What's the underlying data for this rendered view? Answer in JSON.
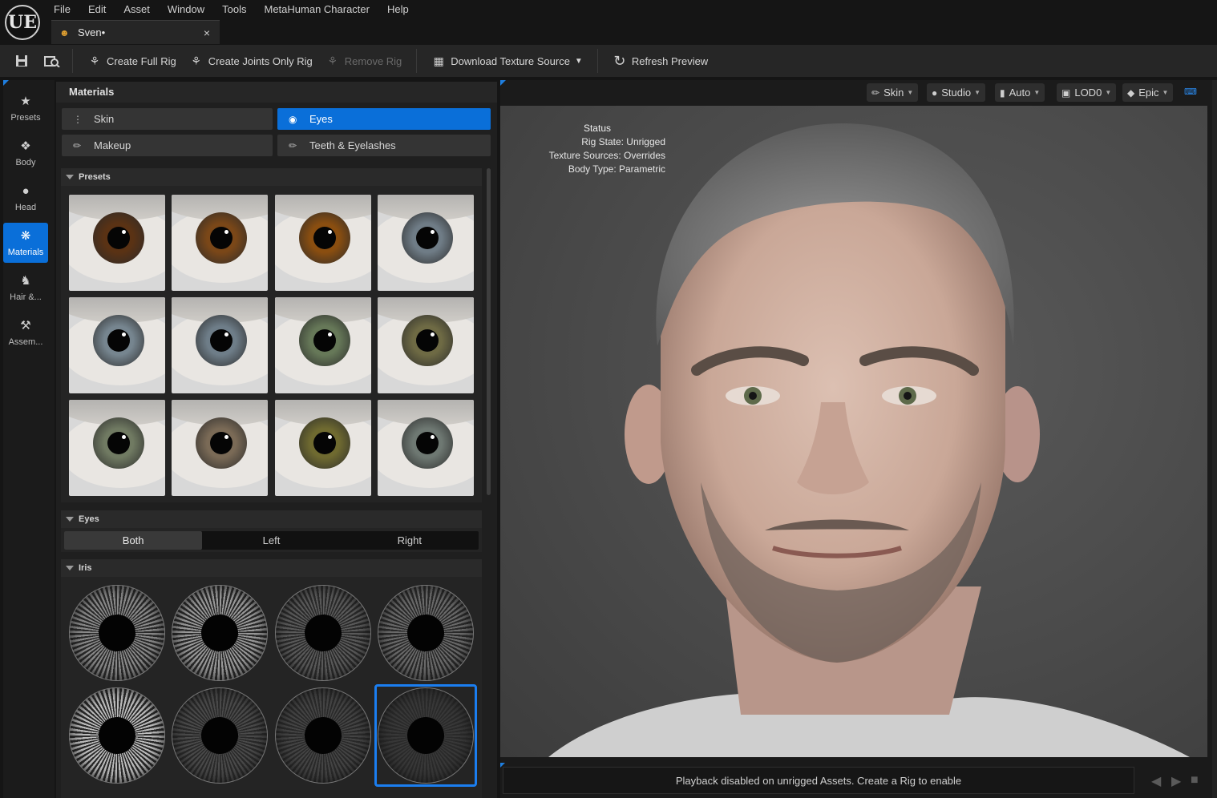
{
  "app": {
    "logo": "UE",
    "menu": [
      "File",
      "Edit",
      "Asset",
      "Window",
      "Tools",
      "MetaHuman Character",
      "Help"
    ],
    "doc_tab": {
      "label": "Sven•",
      "icon": "metahuman-character-icon",
      "close": "×"
    }
  },
  "toolbar": {
    "save_icon": "save-icon",
    "browse_icon": "browse-asset-icon",
    "create_full_rig": "Create Full Rig",
    "create_joints_only_rig": "Create Joints Only Rig",
    "remove_rig": "Remove Rig",
    "download_texture_source": "Download Texture Source",
    "refresh_preview": "Refresh Preview"
  },
  "rail": {
    "items": [
      {
        "label": "Presets",
        "icon": "star-icon",
        "active": false
      },
      {
        "label": "Body",
        "icon": "body-icon",
        "active": false
      },
      {
        "label": "Head",
        "icon": "head-icon",
        "active": false
      },
      {
        "label": "Materials",
        "icon": "materials-icon",
        "active": true
      },
      {
        "label": "Hair &...",
        "icon": "hair-icon",
        "active": false
      },
      {
        "label": "Assem...",
        "icon": "hammer-icon",
        "active": false
      }
    ]
  },
  "panel": {
    "title": "Materials",
    "categories": [
      {
        "label": "Skin",
        "active": false
      },
      {
        "label": "Eyes",
        "active": true
      },
      {
        "label": "Makeup",
        "active": false
      },
      {
        "label": "Teeth & Eyelashes",
        "active": false
      }
    ],
    "presets_header": "Presets",
    "presets": [
      {
        "iris": "#5a3214"
      },
      {
        "iris": "#7a4718"
      },
      {
        "iris": "#8a4e10"
      },
      {
        "iris": "#6f7c86"
      },
      {
        "iris": "#76858f"
      },
      {
        "iris": "#6e7d88"
      },
      {
        "iris": "#667858"
      },
      {
        "iris": "#6e6a44"
      },
      {
        "iris": "#707a62"
      },
      {
        "iris": "#7a6a56"
      },
      {
        "iris": "#6f6a30"
      },
      {
        "iris": "#6e7872"
      }
    ],
    "eyes_header": "Eyes",
    "eye_select": {
      "options": [
        "Both",
        "Left",
        "Right"
      ],
      "selected": "Both"
    },
    "iris_header": "Iris",
    "iris_tiles": [
      {
        "shade": "#8a8a8a"
      },
      {
        "shade": "#9a9a9a"
      },
      {
        "shade": "#5a5a5a"
      },
      {
        "shade": "#6a6a6a"
      },
      {
        "shade": "#bdbdbd"
      },
      {
        "shade": "#4a4a4a"
      },
      {
        "shade": "#444444"
      },
      {
        "shade": "#383838"
      }
    ],
    "iris_selected_index": 7
  },
  "viewport": {
    "buttons": [
      {
        "label": "Skin",
        "icon": "brush-icon"
      },
      {
        "label": "Studio",
        "icon": "bulb-icon"
      },
      {
        "label": "Auto",
        "icon": "camera-icon"
      },
      {
        "label": "LOD0",
        "icon": "cube-icon"
      },
      {
        "label": "Epic",
        "icon": "diamond-icon"
      }
    ],
    "keyboard_icon": "keyboard-icon",
    "status": {
      "title": "Status",
      "rig_state": "Rig State: Unrigged",
      "texture_sources": "Texture Sources: Overrides",
      "body_type": "Body Type: Parametric"
    },
    "playback_message": "Playback disabled on unrigged Assets. Create a Rig to enable"
  },
  "colors": {
    "accent": "#0a6fd9",
    "selection": "#1b7ef0"
  }
}
